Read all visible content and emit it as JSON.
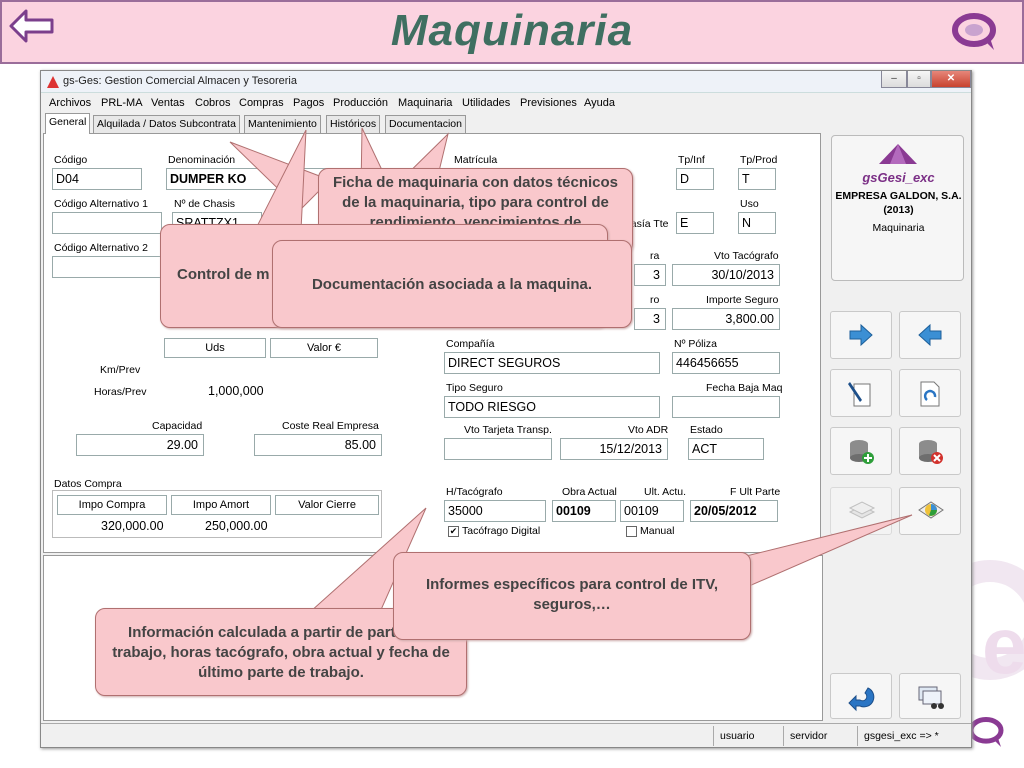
{
  "slide": {
    "title": "Maquinaria"
  },
  "window": {
    "title": "gs-Ges: Gestion Comercial Almacen y Tesoreria"
  },
  "menu": [
    "Archivos",
    "PRL-MA",
    "Ventas",
    "Cobros",
    "Compras",
    "Pagos",
    "Producción",
    "Maquinaria",
    "Utilidades",
    "Previsiones",
    "Ayuda"
  ],
  "tabs": [
    "General",
    "Alquilada / Datos Subcontrata",
    "Mantenimiento",
    "Históricos",
    "Documentacion"
  ],
  "form": {
    "codigo": {
      "label": "Código",
      "value": "D04"
    },
    "denominacion": {
      "label": "Denominación",
      "value": "DUMPER KO"
    },
    "matricula": {
      "label": "Matrícula"
    },
    "tp_inf": {
      "label": "Tp/Inf",
      "value": "D"
    },
    "tp_prod": {
      "label": "Tp/Prod",
      "value": "T"
    },
    "codigo_alt1": {
      "label": "Código Alternativo 1",
      "value": ""
    },
    "chasis": {
      "label": "Nº de Chasis",
      "value": "SRATTZX1"
    },
    "tte": {
      "label": "masía Tte",
      "value": "E"
    },
    "uso": {
      "label": "Uso",
      "value": "N"
    },
    "codigo_alt2": {
      "label": "Código Alternativo 2",
      "value": ""
    },
    "vto_tacografo": {
      "label": "Vto Tacógrafo",
      "value": "30/10/2013"
    },
    "fecha_frag1": {
      "value": "3"
    },
    "fecha_frag2": {
      "value": "3"
    },
    "label_frag1": "ra",
    "label_frag2": "ro",
    "importe_seguro": {
      "label": "Importe Seguro",
      "value": "3,800.00"
    },
    "compania": {
      "label": "Compañía",
      "value": "DIRECT SEGUROS"
    },
    "poliza": {
      "label": "Nº Póliza",
      "value": "446456655"
    },
    "tipo_seguro": {
      "label": "Tipo Seguro",
      "value": "TODO RIESGO"
    },
    "fecha_baja": {
      "label": "Fecha Baja Maq",
      "value": ""
    },
    "vto_tarjeta": {
      "label": "Vto Tarjeta Transp.",
      "value": ""
    },
    "vto_adr": {
      "label": "Vto ADR",
      "value": "15/12/2013"
    },
    "estado": {
      "label": "Estado",
      "value": "ACT"
    },
    "h_tacografo": {
      "label": "H/Tacógrafo",
      "value": "35000"
    },
    "obra_actual": {
      "label": "Obra Actual",
      "value": "00109"
    },
    "ult_actu": {
      "label": "Ult. Actu.",
      "value": "00109"
    },
    "f_ult_parte": {
      "label": "F Ult Parte",
      "value": "20/05/2012"
    },
    "tacografo_digital": {
      "label": "Tacófrago Digital",
      "checked": true
    },
    "manual": {
      "label": "Manual",
      "checked": false
    },
    "uds_hdr": "Uds",
    "valor_hdr": "Valor €",
    "km_prev": "Km/Prev",
    "horas_prev": {
      "label": "Horas/Prev",
      "value": "1,000,000"
    },
    "capacidad": {
      "label": "Capacidad",
      "value": "29.00"
    },
    "coste_real": {
      "label": "Coste Real Empresa",
      "value": "85.00"
    },
    "datos_compra": "Datos Compra",
    "compra_headers": [
      "Impo Compra",
      "Impo Amort",
      "Valor Cierre"
    ],
    "compra_values": [
      "320,000.00",
      "250,000.00",
      ""
    ]
  },
  "brand": {
    "name": "gsGesi_exc",
    "company": "EMPRESA GALDON, S.A.",
    "year": "(2013)",
    "module": "Maquinaria"
  },
  "status": {
    "user": "usuario",
    "server": "servidor",
    "app": "gsgesi_exc => *"
  },
  "callouts": {
    "ficha": "Ficha de maquinaria con datos técnicos de la maquinaria, tipo para control de rendimiento, vencimientos de",
    "control": "Control de m",
    "documentacion": "Documentación asociada a la maquina.",
    "informes": "Informes específicos para control de ITV, seguros,…",
    "informacion": "Información calculada a partir de partes de trabajo, horas tacógrafo, obra actual y fecha de último parte de trabajo."
  },
  "colors": {
    "title": "#3f6f61",
    "header_bg": "#fbd3e0",
    "callout_bg": "#f9c8cc",
    "brand_accent": "#7b2f86"
  }
}
